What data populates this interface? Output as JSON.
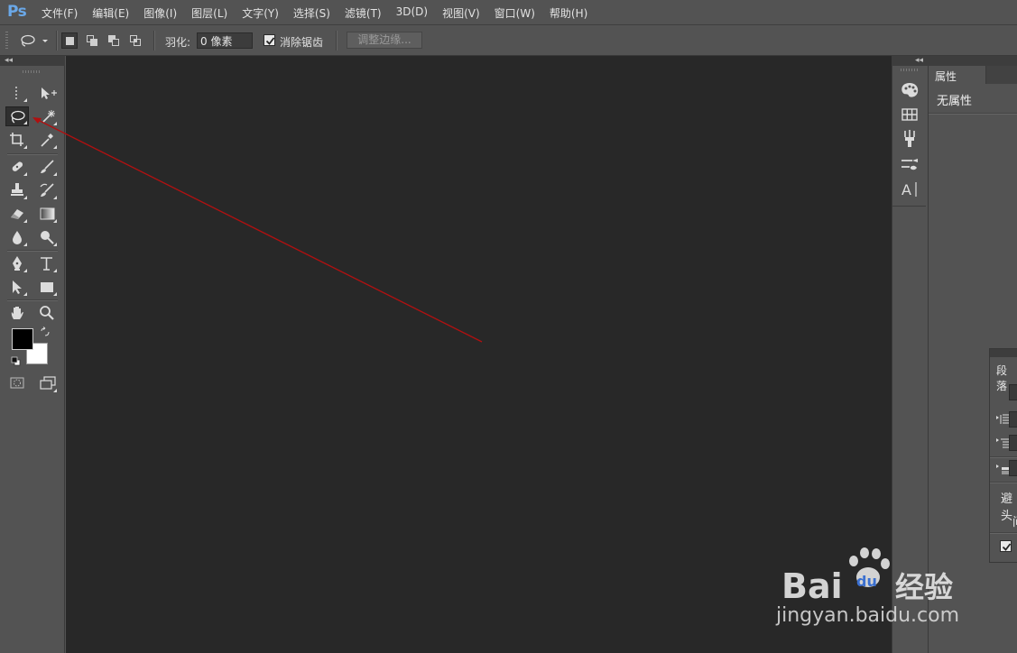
{
  "app": {
    "logo": "Ps"
  },
  "menu": {
    "items": [
      "文件(F)",
      "编辑(E)",
      "图像(I)",
      "图层(L)",
      "文字(Y)",
      "选择(S)",
      "滤镜(T)",
      "3D(D)",
      "视图(V)",
      "窗口(W)",
      "帮助(H)"
    ]
  },
  "options": {
    "feather_label": "羽化:",
    "feather_value": "0 像素",
    "antialias_label": "消除锯齿",
    "antialias_checked": true,
    "refine_edge_label": "调整边缘..."
  },
  "tools": {
    "active": "lasso-tool",
    "foreground_color": "#000000",
    "background_color": "#ffffff"
  },
  "properties_panel": {
    "tab_label": "属性",
    "content": "无属性"
  },
  "paragraph_panel": {
    "tab_label": "段落",
    "partial_text_1": "避头",
    "partial_text_2": "间"
  },
  "annotation": {
    "color": "#b01010"
  },
  "watermark": {
    "text": "jingyan.baidu.com",
    "logo_text_1": "Bai",
    "logo_text_2": "du",
    "logo_text_3": "经验"
  }
}
